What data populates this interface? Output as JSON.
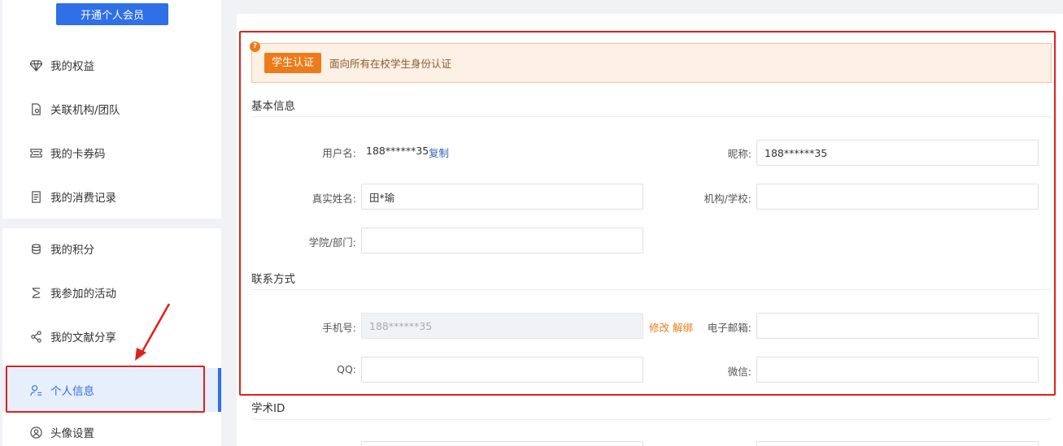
{
  "sidebar": {
    "vip_button": "开通个人会员",
    "items": [
      {
        "label": "我的权益",
        "icon": "diamond-icon"
      },
      {
        "label": "关联机构/团队",
        "icon": "document-link-icon"
      },
      {
        "label": "我的卡券码",
        "icon": "ticket-icon"
      },
      {
        "label": "我的消费记录",
        "icon": "receipt-icon"
      },
      {
        "label": "我的积分",
        "icon": "coins-icon"
      },
      {
        "label": "我参加的活动",
        "icon": "activity-icon"
      },
      {
        "label": "我的文献分享",
        "icon": "share-icon"
      },
      {
        "label": "个人信息",
        "icon": "user-info-icon",
        "active": true
      },
      {
        "label": "头像设置",
        "icon": "avatar-icon"
      }
    ]
  },
  "certification": {
    "tag": "学生认证",
    "description": "面向所有在校学生身份认证",
    "badge": "?"
  },
  "basic_info": {
    "title": "基本信息",
    "username_label": "用户名:",
    "username_value": "188******35",
    "copy_link": "复制",
    "nickname_label": "昵称:",
    "nickname_value": "188******35",
    "realname_label": "真实姓名:",
    "realname_value": "田*瑜",
    "org_label": "机构/学校:",
    "org_value": "",
    "dept_label": "学院/部门:",
    "dept_value": ""
  },
  "contact": {
    "title": "联系方式",
    "phone_label": "手机号:",
    "phone_value": "188******35",
    "modify_link": "修改",
    "unbind_link": "解绑",
    "email_label": "电子邮箱:",
    "email_value": "",
    "qq_label": "QQ:",
    "qq_value": "",
    "wechat_label": "微信:",
    "wechat_value": ""
  },
  "academic": {
    "title": "学术ID"
  },
  "colors": {
    "accent": "#2f6fe8",
    "highlight_red": "#e0201c",
    "cert_orange": "#ec7b1a"
  }
}
